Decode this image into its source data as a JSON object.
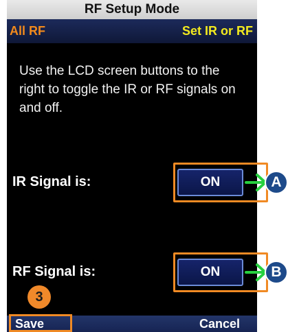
{
  "title": "RF Setup Mode",
  "header": {
    "left": "All RF",
    "right": "Set IR or RF"
  },
  "instructions": "Use the LCD screen buttons to the right to toggle the IR or RF signals on and off.",
  "ir": {
    "label": "IR Signal is:",
    "button": "ON",
    "callout": "A"
  },
  "rf": {
    "label": "RF Signal is:",
    "button": "ON",
    "callout": "B"
  },
  "step": "3",
  "footer": {
    "save": "Save",
    "cancel": "Cancel"
  },
  "colors": {
    "callout_frame": "#f08a24",
    "arrow": "#27d13f",
    "header_left": "#f28a1c",
    "header_right": "#f3ea1f"
  },
  "icons": {
    "arrow": "arrow-right-icon"
  }
}
